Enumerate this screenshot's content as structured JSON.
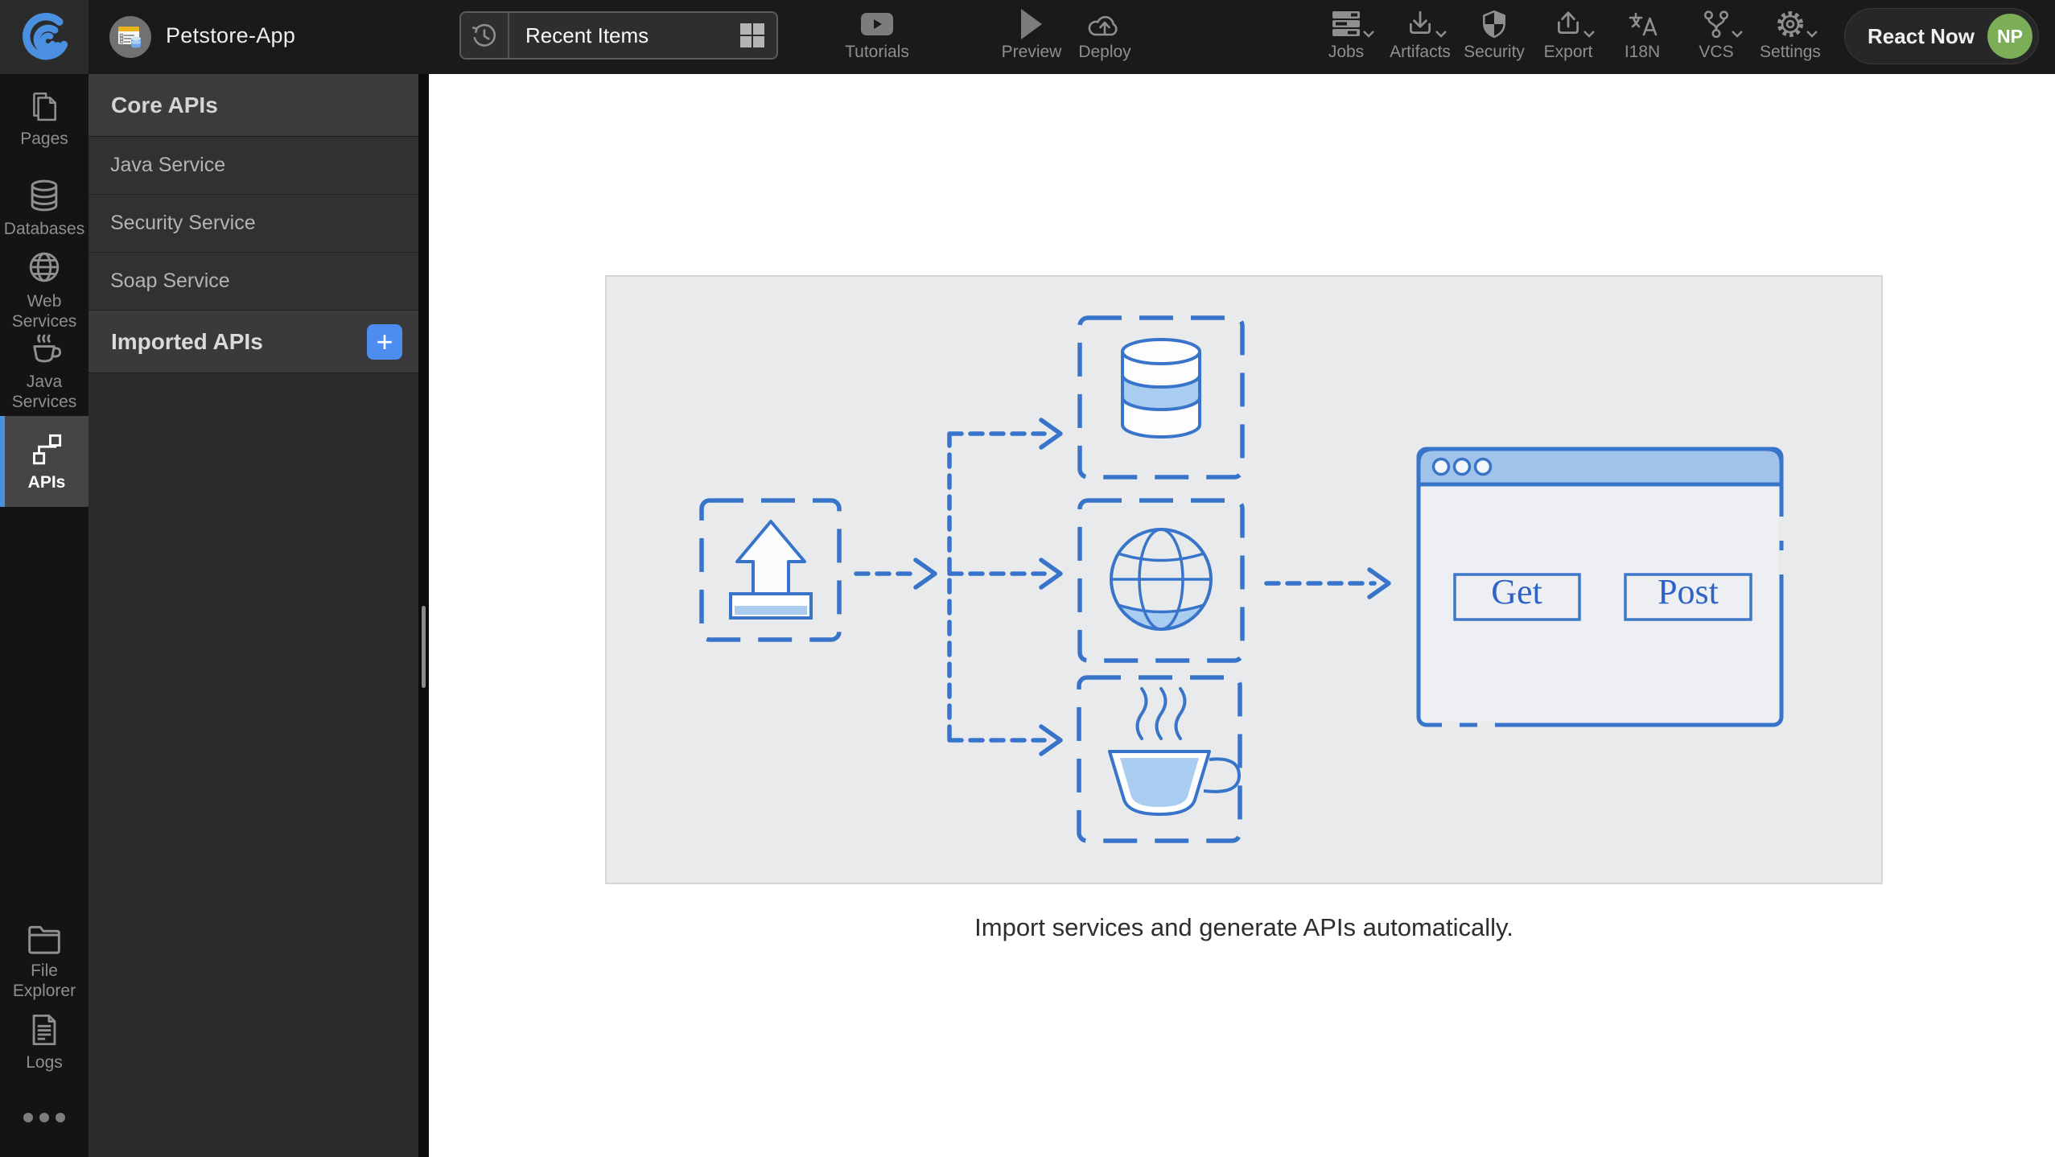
{
  "header": {
    "app_name": "Petstore-App",
    "recent_items_label": "Recent Items",
    "toolbar_left": [
      {
        "label": "Tutorials"
      },
      {
        "label": "Preview"
      },
      {
        "label": "Deploy"
      }
    ],
    "toolbar_right": [
      {
        "label": "Jobs",
        "chevron": true
      },
      {
        "label": "Artifacts",
        "chevron": true
      },
      {
        "label": "Security",
        "chevron": false
      },
      {
        "label": "Export",
        "chevron": true
      },
      {
        "label": "I18N",
        "chevron": false
      },
      {
        "label": "VCS",
        "chevron": true
      },
      {
        "label": "Settings",
        "chevron": true
      }
    ],
    "react_now_label": "React Now",
    "avatar_initials": "NP"
  },
  "sidebar": {
    "items": [
      {
        "label": "Pages"
      },
      {
        "label": "Databases"
      },
      {
        "label": "Web Services"
      },
      {
        "label": "Java Services"
      },
      {
        "label": "APIs",
        "active": true
      },
      {
        "label": "File Explorer"
      },
      {
        "label": "Logs"
      }
    ]
  },
  "panel": {
    "core_header": "Core APIs",
    "items": [
      {
        "label": "Java Service"
      },
      {
        "label": "Security Service"
      },
      {
        "label": "Soap Service"
      }
    ],
    "imported_header": "Imported APIs",
    "add_button_label": "+"
  },
  "main": {
    "caption": "Import services and generate APIs automatically.",
    "diagram": {
      "get_label": "Get",
      "post_label": "Post"
    }
  },
  "colors": {
    "accent_blue": "#4a90e2",
    "diagram_stroke_blue": "#3874c9",
    "diagram_fill_light_blue": "#a9cdf1",
    "browser_titlebar_blue": "#9fc3ea",
    "add_button_blue": "#4d8cf0",
    "avatar_green": "#7bae57",
    "header_bg": "#1a1a1a",
    "sidebar_bg": "#141414",
    "panel_bg": "#2b2b2d",
    "illustration_bg": "#e9eaec"
  }
}
